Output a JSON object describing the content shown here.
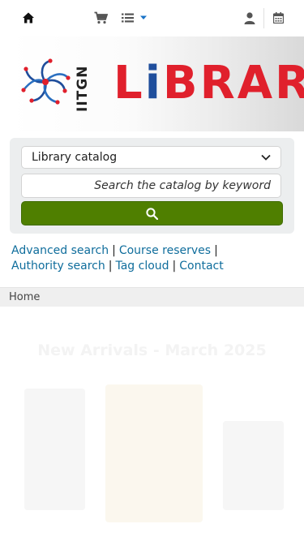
{
  "topbar": {
    "home_icon": "home-icon",
    "cart_icon": "cart-icon",
    "lists_icon": "list-icon",
    "login_icon": "user-icon",
    "calendar_icon": "calendar-icon"
  },
  "logo": {
    "org_text": "IITGN",
    "library_letters": [
      "L",
      "i",
      "B",
      "R",
      "A",
      "R"
    ]
  },
  "search": {
    "select_value": "Library catalog",
    "keyword_placeholder": "Search the catalog by keyword",
    "submit_icon": "search-icon"
  },
  "links": {
    "advanced": "Advanced search",
    "course": "Course reserves",
    "authority": "Authority search",
    "tagcloud": "Tag cloud",
    "contact": "Contact",
    "separator": "|"
  },
  "breadcrumb": {
    "home": "Home"
  },
  "news": {
    "title": "New Arrivals - March 2025"
  },
  "colors": {
    "accent_green": "#4f7f00",
    "link_blue": "#0f6d9c",
    "logo_red": "#e0202c",
    "logo_blue": "#1f4e9c"
  }
}
